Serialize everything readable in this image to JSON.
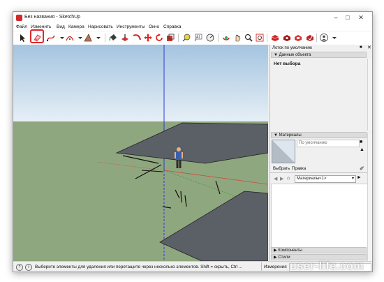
{
  "window": {
    "title": "Без названия - SketchUp",
    "minimize_icon": "minimize-icon",
    "maximize_icon": "maximize-icon",
    "close_icon": "close-icon"
  },
  "menu": [
    "Файл",
    "Изменить",
    "Вид",
    "Камера",
    "Нарисовать",
    "Инструменты",
    "Окно",
    "Справка"
  ],
  "toolbar": {
    "tools": [
      "select-icon",
      "eraser-icon",
      "line-icon",
      "arc-icon",
      "shape-icon",
      "paint-bucket-icon",
      "push-pull-icon",
      "follow-me-icon",
      "move-icon",
      "rotate-icon",
      "scale-icon",
      "tape-measure-icon",
      "text-icon",
      "protractor-icon",
      "orbit-icon",
      "pan-icon",
      "zoom-icon",
      "zoom-extents-icon",
      "3d-warehouse-icon",
      "extension-warehouse-icon",
      "layout-icon",
      "extension-manager-icon",
      "account-icon"
    ],
    "highlighted_tool": "eraser-icon",
    "highlight_color": "#e0272c"
  },
  "tray": {
    "title": "Лоток по умолчанию",
    "entity_info": {
      "header": "Данные объекта",
      "value": "Нет выбора"
    },
    "materials": {
      "header": "Материалы",
      "default_label": "По умолчанию",
      "tab_select": "Выбрать",
      "tab_edit": "Правка",
      "dropdown_value": "Материалы<1>"
    },
    "components_header": "Компоненты",
    "styles_header": "Стили"
  },
  "status": {
    "hint": "Выберите элементы для удаления или перетащите через несколько элементов. Shift = скрыть, Ctrl ...",
    "measure_label": "Измерения"
  },
  "colors": {
    "sky_top": "#a4c4e0",
    "sky_bottom": "#e6eff6",
    "ground": "#8fa77f",
    "face": "#5b5f66",
    "blue_axis": "#2b3bd0",
    "red_axis": "#d04a3a"
  },
  "watermark": "user-life.com"
}
